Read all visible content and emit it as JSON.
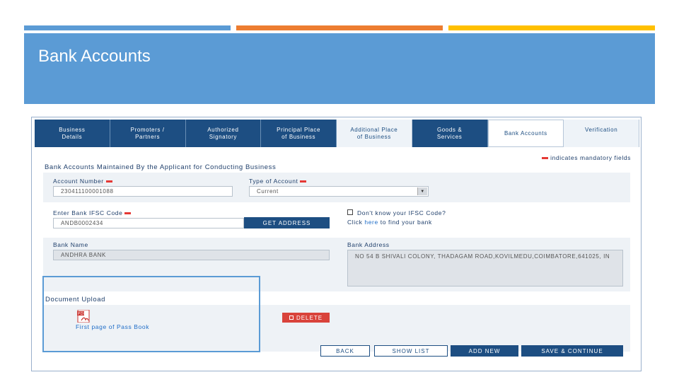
{
  "slide": {
    "title": "Bank Accounts"
  },
  "tabs": [
    {
      "label": "Business\nDetails"
    },
    {
      "label": "Promoters /\nPartners"
    },
    {
      "label": "Authorized\nSignatory"
    },
    {
      "label": "Principal Place\nof Business"
    },
    {
      "label": "Additional Place\nof Business"
    },
    {
      "label": "Goods &\nServices"
    },
    {
      "label": "Bank Accounts"
    },
    {
      "label": "Verification"
    }
  ],
  "form": {
    "mandatory_note": "indicates mandatory fields",
    "section_heading": "Bank Accounts Maintained By the Applicant for Conducting Business",
    "account_number_label": "Account Number",
    "account_number_value": "230411100001088",
    "account_type_label": "Type of Account",
    "account_type_value": "Current",
    "ifsc_label": "Enter Bank IFSC Code",
    "ifsc_value": "ANDB0002434",
    "get_address_button": "GET ADDRESS",
    "dont_know_ifsc": "Don't know your IFSC Code?",
    "click_prefix": "Click",
    "click_link": "here",
    "click_suffix": "to find your bank",
    "bank_name_label": "Bank Name",
    "bank_name_value": "ANDHRA BANK",
    "bank_address_label": "Bank Address",
    "bank_address_value": "NO 54 B SHIVALI COLONY, THADAGAM ROAD,KOVILMEDU,COIMBATORE,641025, IN"
  },
  "document": {
    "heading": "Document Upload",
    "file_label": "First page of Pass Book",
    "delete_button": "DELETE",
    "pdf_icon_text": "PDF"
  },
  "actions": {
    "back": "BACK",
    "show_list": "SHOW LIST",
    "add_new": "ADD NEW",
    "save_continue": "SAVE & CONTINUE"
  },
  "colors": {
    "slide_accent_blue": "#5b9bd5",
    "slide_accent_orange": "#ed7d31",
    "slide_accent_yellow": "#ffc000",
    "tab_dark": "#1d4e82",
    "mandatory_red": "#e53935"
  }
}
